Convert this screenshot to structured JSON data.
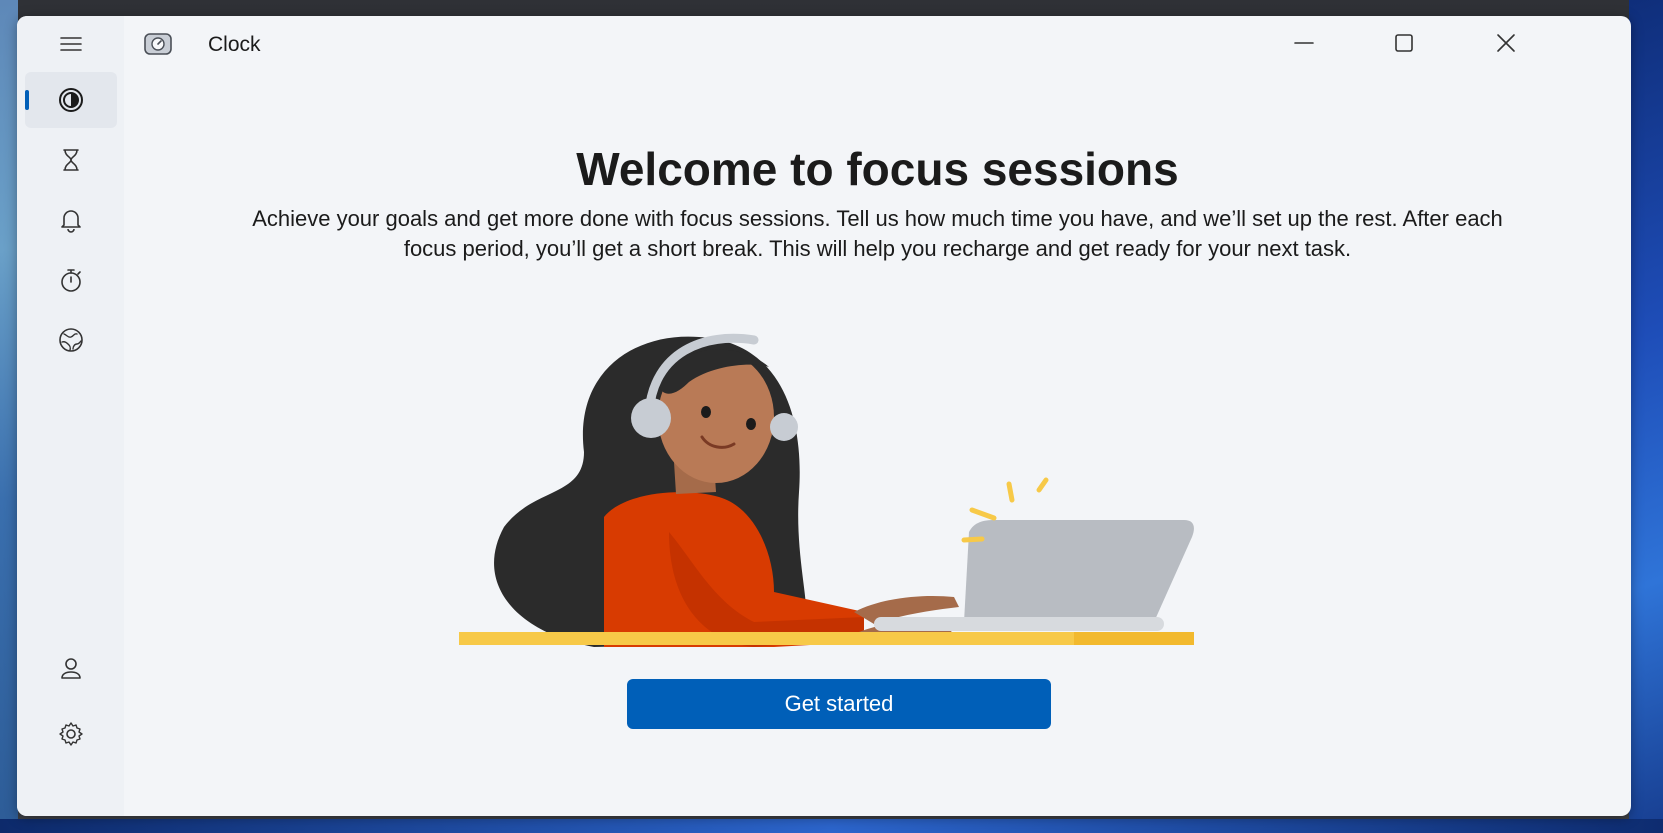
{
  "app": {
    "title": "Clock",
    "icon": "clock-app-icon"
  },
  "titlebar": {
    "buttons": [
      {
        "name": "minimize-button",
        "icon": "minimize-icon"
      },
      {
        "name": "maximize-button",
        "icon": "maximize-icon"
      },
      {
        "name": "close-button",
        "icon": "close-icon"
      }
    ]
  },
  "sidebar": {
    "menu_icon": "hamburger-icon",
    "items": [
      {
        "id": "focus-sessions",
        "icon": "focus-icon",
        "active": true
      },
      {
        "id": "timer",
        "icon": "hourglass-icon",
        "active": false
      },
      {
        "id": "alarm",
        "icon": "bell-icon",
        "active": false
      },
      {
        "id": "stopwatch",
        "icon": "stopwatch-icon",
        "active": false
      },
      {
        "id": "world-clock",
        "icon": "globe-icon",
        "active": false
      }
    ],
    "bottom_items": [
      {
        "id": "account",
        "icon": "person-icon"
      },
      {
        "id": "settings",
        "icon": "gear-icon"
      }
    ]
  },
  "main": {
    "heading": "Welcome to focus sessions",
    "description": "Achieve your goals and get more done with focus sessions. Tell us how much time you have, and we’ll set up the rest. After each focus period, you’ll get a short break. This will help you recharge and get ready for your next task.",
    "illustration": "woman-with-headphones-on-laptop-illustration",
    "button_label": "Get started"
  },
  "colors": {
    "accent": "#005fb8",
    "window_bg": "#f3f5f8",
    "sidebar_bg": "#eef1f5",
    "shirt": "#d83b01",
    "desk": "#f7c948",
    "laptop": "#b8bcc2"
  }
}
